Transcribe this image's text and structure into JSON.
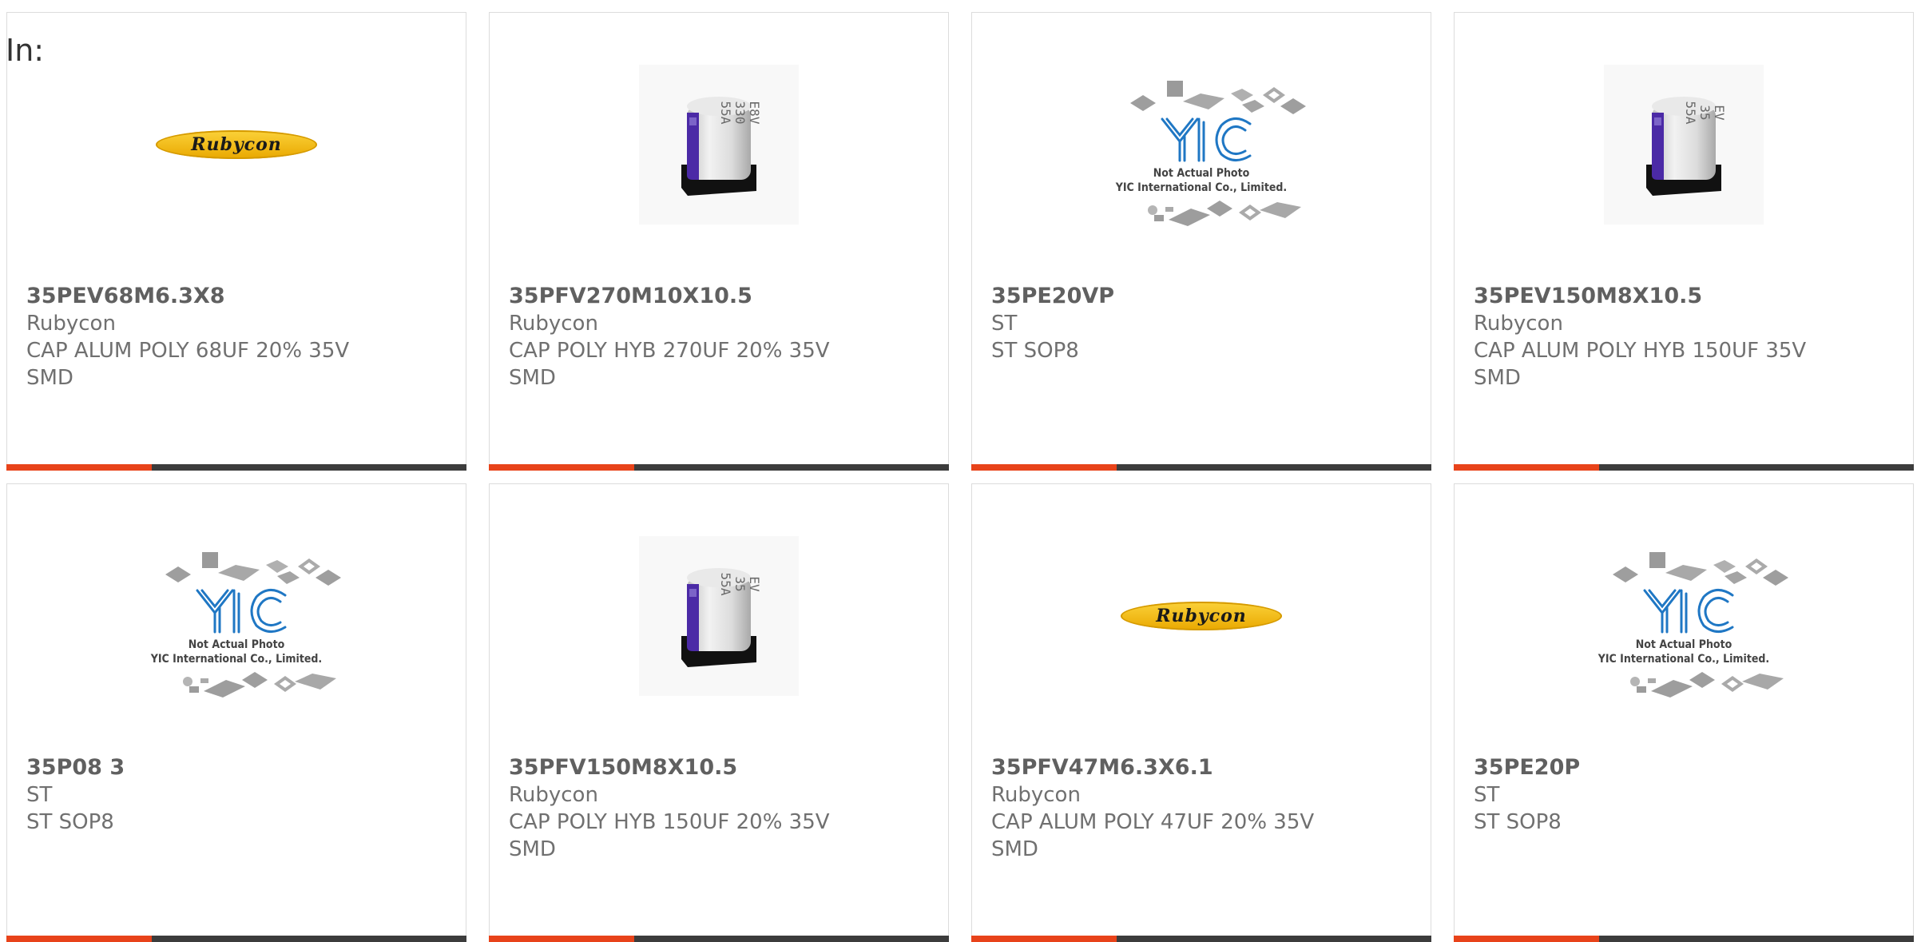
{
  "header": {
    "label": "In:"
  },
  "cards": [
    {
      "part": "35PEV68M6.3X8",
      "manufacturer": "Rubycon",
      "desc1": "CAP ALUM POLY 68UF 20% 35V",
      "desc2": "SMD",
      "image": "rubycon-logo"
    },
    {
      "part": "35PFV270M10X10.5",
      "manufacturer": "Rubycon",
      "desc1": "CAP POLY HYB 270UF 20% 35V",
      "desc2": "SMD",
      "image": "capacitor-photo",
      "cap_lines": [
        "55A",
        "330",
        "E8V"
      ]
    },
    {
      "part": "35PE20VP",
      "manufacturer": "ST",
      "desc1": "ST SOP8",
      "desc2": "",
      "image": "yic-placeholder"
    },
    {
      "part": "35PEV150M8X10.5",
      "manufacturer": "Rubycon",
      "desc1": "CAP ALUM POLY HYB 150UF 35V",
      "desc2": "SMD",
      "image": "capacitor-photo",
      "cap_lines": [
        "55A",
        "35",
        "EV"
      ]
    },
    {
      "part": "35P08 3",
      "manufacturer": "ST",
      "desc1": "ST SOP8",
      "desc2": "",
      "image": "yic-placeholder"
    },
    {
      "part": "35PFV150M8X10.5",
      "manufacturer": "Rubycon",
      "desc1": "CAP POLY HYB 150UF 20% 35V",
      "desc2": "SMD",
      "image": "capacitor-photo",
      "cap_lines": [
        "55A",
        "35",
        "EV"
      ]
    },
    {
      "part": "35PFV47M6.3X6.1",
      "manufacturer": "Rubycon",
      "desc1": "CAP ALUM POLY 47UF 20% 35V",
      "desc2": "SMD",
      "image": "rubycon-logo"
    },
    {
      "part": "35PE20P",
      "manufacturer": "ST",
      "desc1": "ST SOP8",
      "desc2": "",
      "image": "yic-placeholder"
    }
  ],
  "logo": {
    "rubycon_text": "Rubycon"
  },
  "placeholder": {
    "line1": "Not Actual Photo",
    "line2": "YIC International Co., Limited.",
    "brand": "YIC"
  },
  "colors": {
    "accent": "#e8431a",
    "bar": "#3c3c3c",
    "yic_blue": "#1f77c4"
  }
}
